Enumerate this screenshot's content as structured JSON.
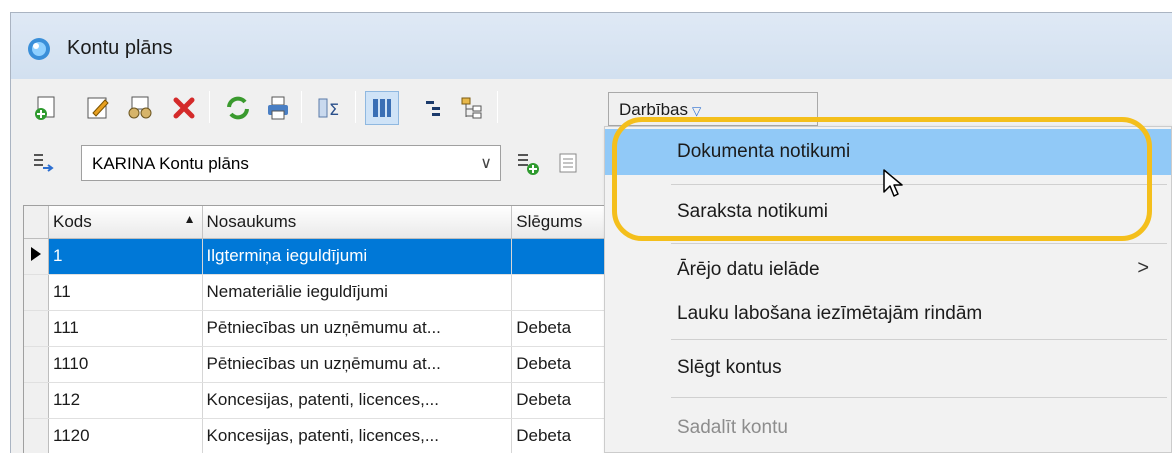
{
  "window": {
    "title": "Kontu plāns"
  },
  "toolbar": {
    "icons": [
      "new-doc-icon",
      "edit-icon",
      "view-icon",
      "delete-icon",
      "refresh-icon",
      "print-icon",
      "sum-icon",
      "columns-icon",
      "tree-expand-icon",
      "tree-icon"
    ],
    "actions_label": "Darbības"
  },
  "filter": {
    "selected_plan": "KARINA Kontu plāns"
  },
  "grid": {
    "columns": [
      "Kods",
      "Nosaukums",
      "Slēgums"
    ],
    "rows": [
      {
        "kods": "1",
        "nosaukums": "Ilgtermiņa ieguldījumi",
        "slegums": ""
      },
      {
        "kods": "11",
        "nosaukums": "Nemateriālie ieguldījumi",
        "slegums": ""
      },
      {
        "kods": "111",
        "nosaukums": "Pētniecības un uzņēmumu at...",
        "slegums": "Debeta"
      },
      {
        "kods": "1110",
        "nosaukums": "Pētniecības un uzņēmumu at...",
        "slegums": "Debeta"
      },
      {
        "kods": "112",
        "nosaukums": "Koncesijas, patenti, licences,...",
        "slegums": "Debeta"
      },
      {
        "kods": "1120",
        "nosaukums": "Koncesijas, patenti, licences,...",
        "slegums": "Debeta"
      }
    ]
  },
  "menu": {
    "items": [
      {
        "label": "Dokumenta notikumi"
      },
      {
        "label": "Saraksta notikumi"
      },
      {
        "label": "Ārējo datu ielāde",
        "submenu_glyph": ">"
      },
      {
        "label": "Lauku labošana iezīmētajām rindām"
      },
      {
        "label": "Slēgt kontus"
      },
      {
        "label": "Sadalīt kontu"
      }
    ]
  },
  "colors": {
    "selection": "#0078d7",
    "menu_hover": "#91c9f7",
    "highlight": "#f4bf1c"
  }
}
